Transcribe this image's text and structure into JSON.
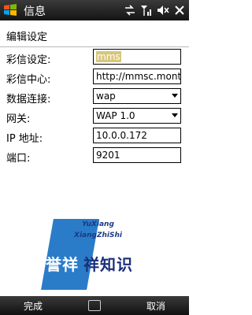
{
  "titlebar": {
    "title": "信息"
  },
  "header": {
    "title": "编辑设定"
  },
  "form": {
    "mms_settings_label": "彩信设定:",
    "mms_settings_value": "mms",
    "mms_center_label": "彩信中心:",
    "mms_center_value": "http://mmsc.mont",
    "data_connection_label": "数据连接:",
    "data_connection_value": "wap",
    "gateway_label": "网关:",
    "gateway_value": "WAP 1.0",
    "ip_label": "IP 地址:",
    "ip_value": "10.0.0.172",
    "port_label": "端口:",
    "port_value": "9201"
  },
  "watermark": {
    "line1": "YuXiang",
    "line2": "XiangZhiShi",
    "cn_left": "誉祥",
    "cn_right": "祥知识"
  },
  "softkeys": {
    "left": "完成",
    "right": "取消"
  }
}
